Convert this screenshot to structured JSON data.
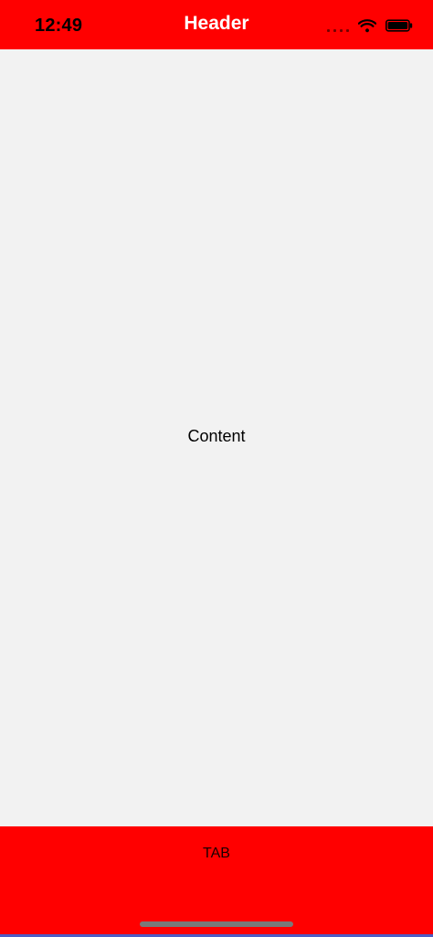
{
  "status_bar": {
    "time": "12:49",
    "icons": [
      "signal-dots-icon",
      "wifi-icon",
      "battery-icon"
    ]
  },
  "header": {
    "title": "Header",
    "background": "#ff0000",
    "title_color": "#ffffff"
  },
  "content": {
    "label": "Content",
    "background": "#f2f2f2"
  },
  "tabbar": {
    "label": "TAB",
    "background": "#ff0000"
  },
  "colors": {
    "accent_red": "#ff0000",
    "content_gray": "#f2f2f2",
    "home_indicator": "#7a7a7a",
    "bottom_strip_blue": "#3a66d8"
  }
}
